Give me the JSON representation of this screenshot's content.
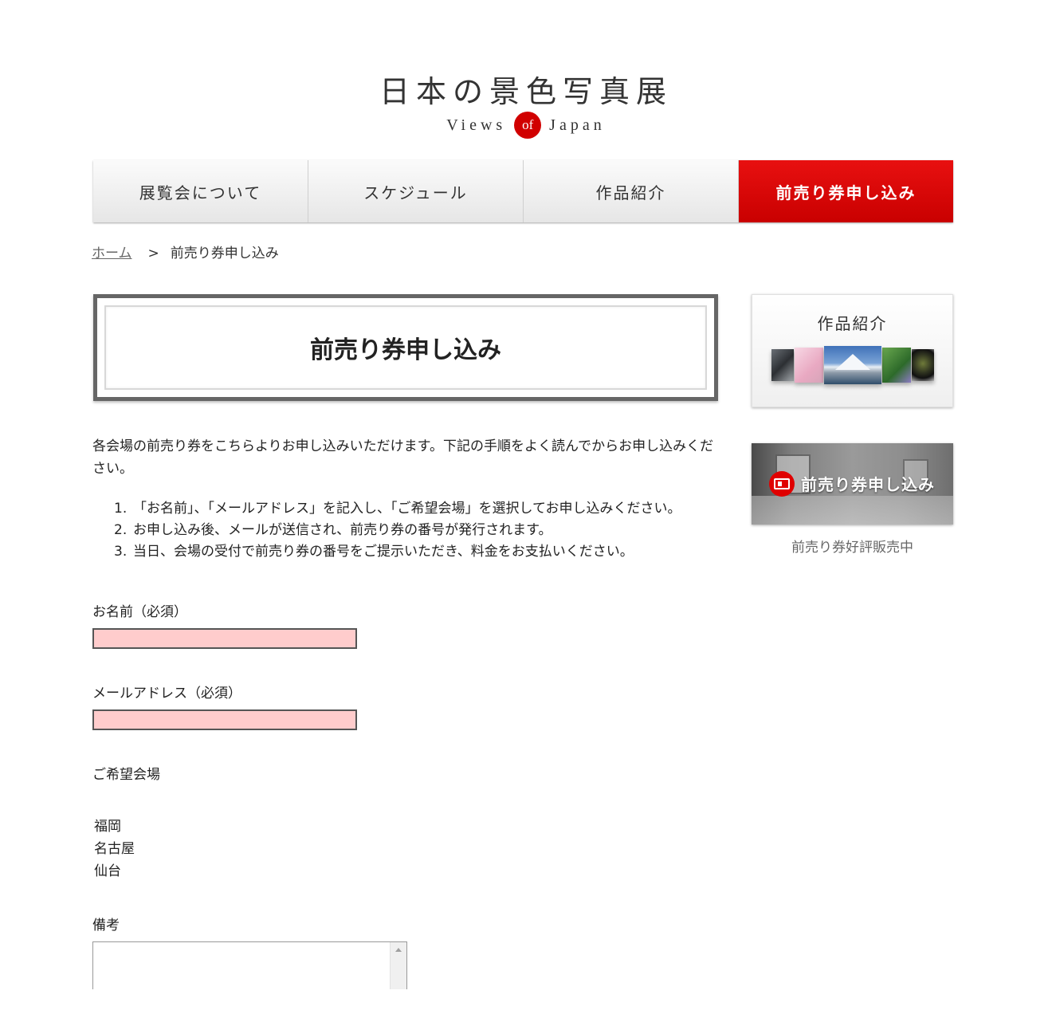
{
  "logo": {
    "title": "日本の景色写真展",
    "sub_left": "Views",
    "sub_of": "of",
    "sub_right": "Japan",
    "accent_color": "#d10000"
  },
  "nav": {
    "items": [
      {
        "label": "展覧会について"
      },
      {
        "label": "スケジュール"
      },
      {
        "label": "作品紹介"
      },
      {
        "label": "前売り券申し込み",
        "active": true
      }
    ],
    "active_color": "#e00000"
  },
  "breadcrumb": {
    "home": "ホーム",
    "separator": ">",
    "current": "前売り券申し込み"
  },
  "page_title": "前売り券申し込み",
  "intro": "各会場の前売り券をこちらよりお申し込みいただけます。下記の手順をよく読んでからお申し込みください。",
  "steps": [
    {
      "num": "1.",
      "text": "「お名前」、「メールアドレス」を記入し、「ご希望会場」を選択してお申し込みください。"
    },
    {
      "num": "2.",
      "text": "お申し込み後、メールが送信され、前売り券の番号が発行されます。"
    },
    {
      "num": "3.",
      "text": "当日、会場の受付で前売り券の番号をご提示いただき、料金をお支払いください。"
    }
  ],
  "form": {
    "name_label": "お名前（必須）",
    "name_value": "",
    "email_label": "メールアドレス（必須）",
    "email_value": "",
    "venue_label": "ご希望会場",
    "venues": [
      "福岡",
      "名古屋",
      "仙台"
    ],
    "notes_label": "備考",
    "notes_value": "",
    "input_bg": "#ffcccc"
  },
  "sidebar": {
    "works_title": "作品紹介",
    "ticket_label": "前売り券申し込み",
    "ticket_caption": "前売り券好評販売中"
  }
}
